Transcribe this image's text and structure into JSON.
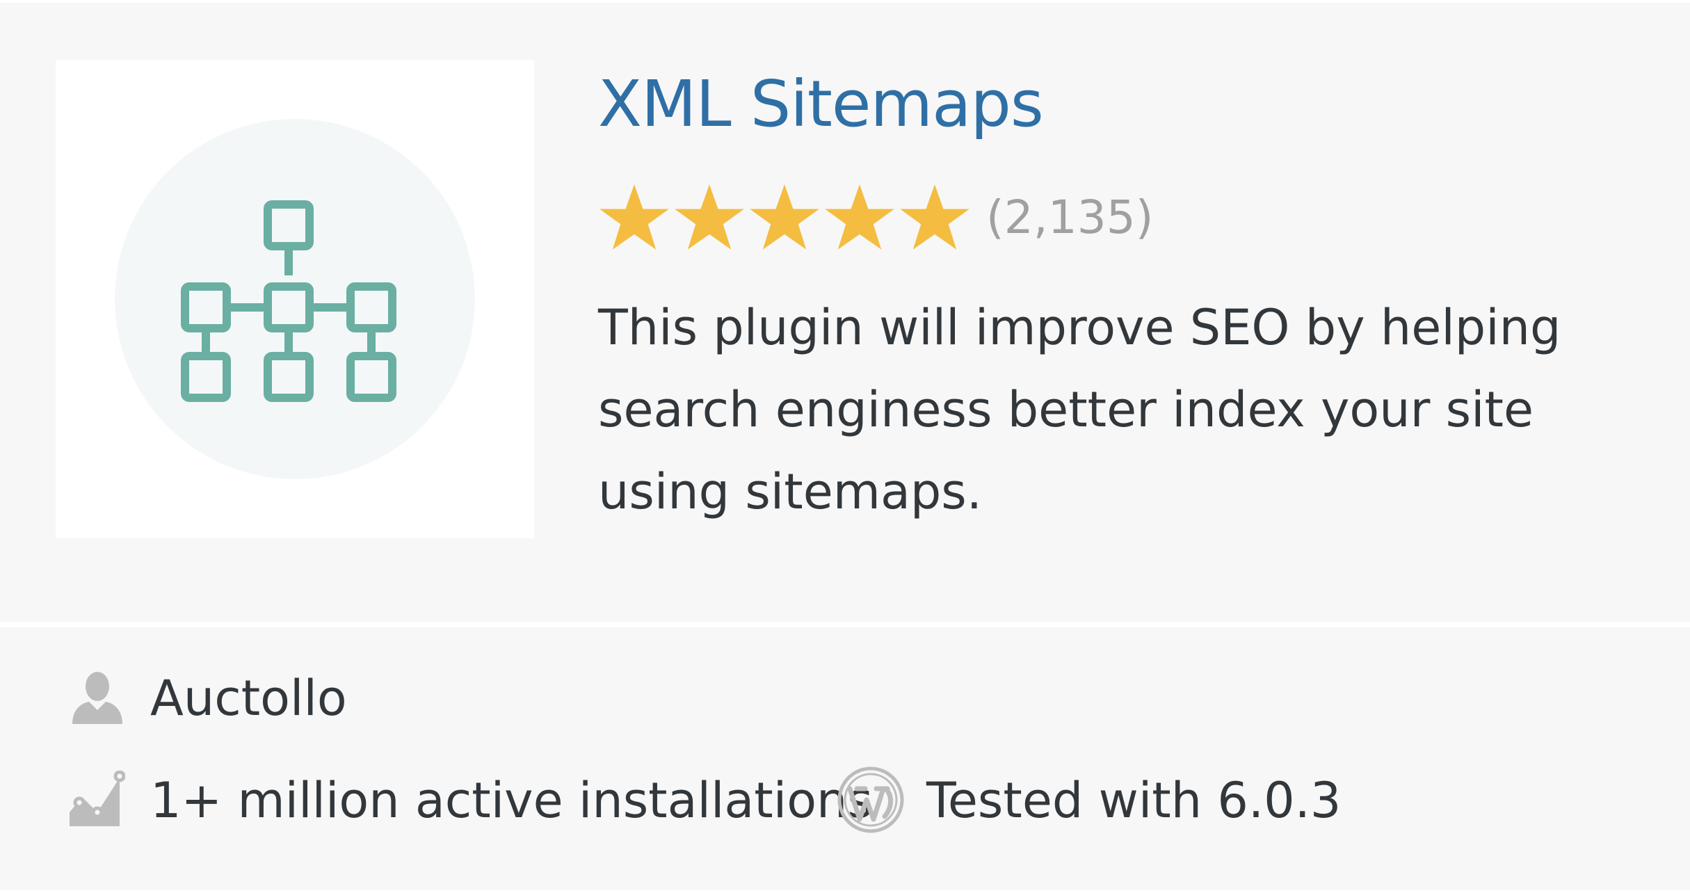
{
  "plugin": {
    "title": "XML Sitemaps",
    "rating": {
      "stars": 5,
      "max_stars": 5,
      "count_label": "(2,135)"
    },
    "description": "This plugin will improve SEO by helping search enginess better index your site using sitemaps."
  },
  "footer": {
    "author": "Auctollo",
    "installs": "1+ million active installations",
    "tested": "Tested with 6.0.3"
  },
  "icons": {
    "plugin_icon": "sitemap-icon",
    "author_icon": "user-icon",
    "installs_icon": "chart-icon",
    "tested_icon": "wordpress-icon"
  },
  "colors": {
    "title": "#2f6fa5",
    "star": "#f4bd41",
    "icon_teal": "#6aafa2",
    "muted_icon": "#bcbcbc",
    "card_background": "#f7f7f7"
  }
}
